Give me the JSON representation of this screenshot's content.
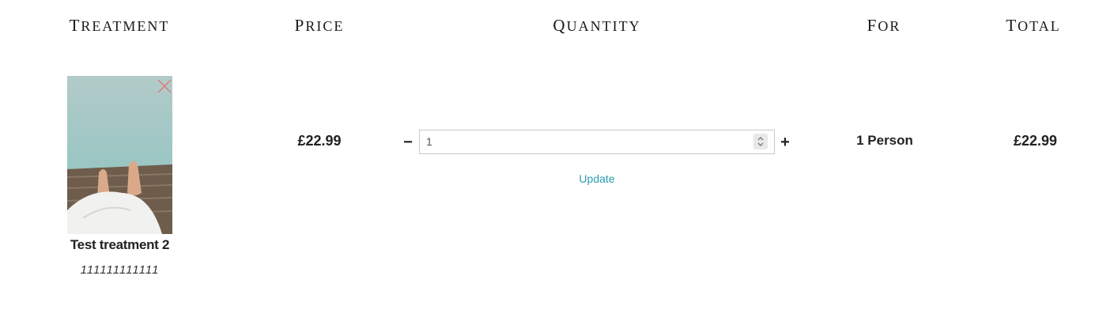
{
  "headers": {
    "treatment": "Treatment",
    "price": "Price",
    "quantity": "Quantity",
    "for": "For",
    "total": "Total"
  },
  "item": {
    "name": "Test treatment 2",
    "code": "111111111111",
    "price": "£22.99",
    "quantity": "1",
    "for": "1 Person",
    "total": "£22.99",
    "image_icon": "treatment-photo",
    "remove_icon": "close-icon"
  },
  "controls": {
    "minus": "−",
    "plus": "+",
    "update": "Update"
  },
  "colors": {
    "link": "#2b9bb0",
    "remove": "#e07a7a"
  }
}
